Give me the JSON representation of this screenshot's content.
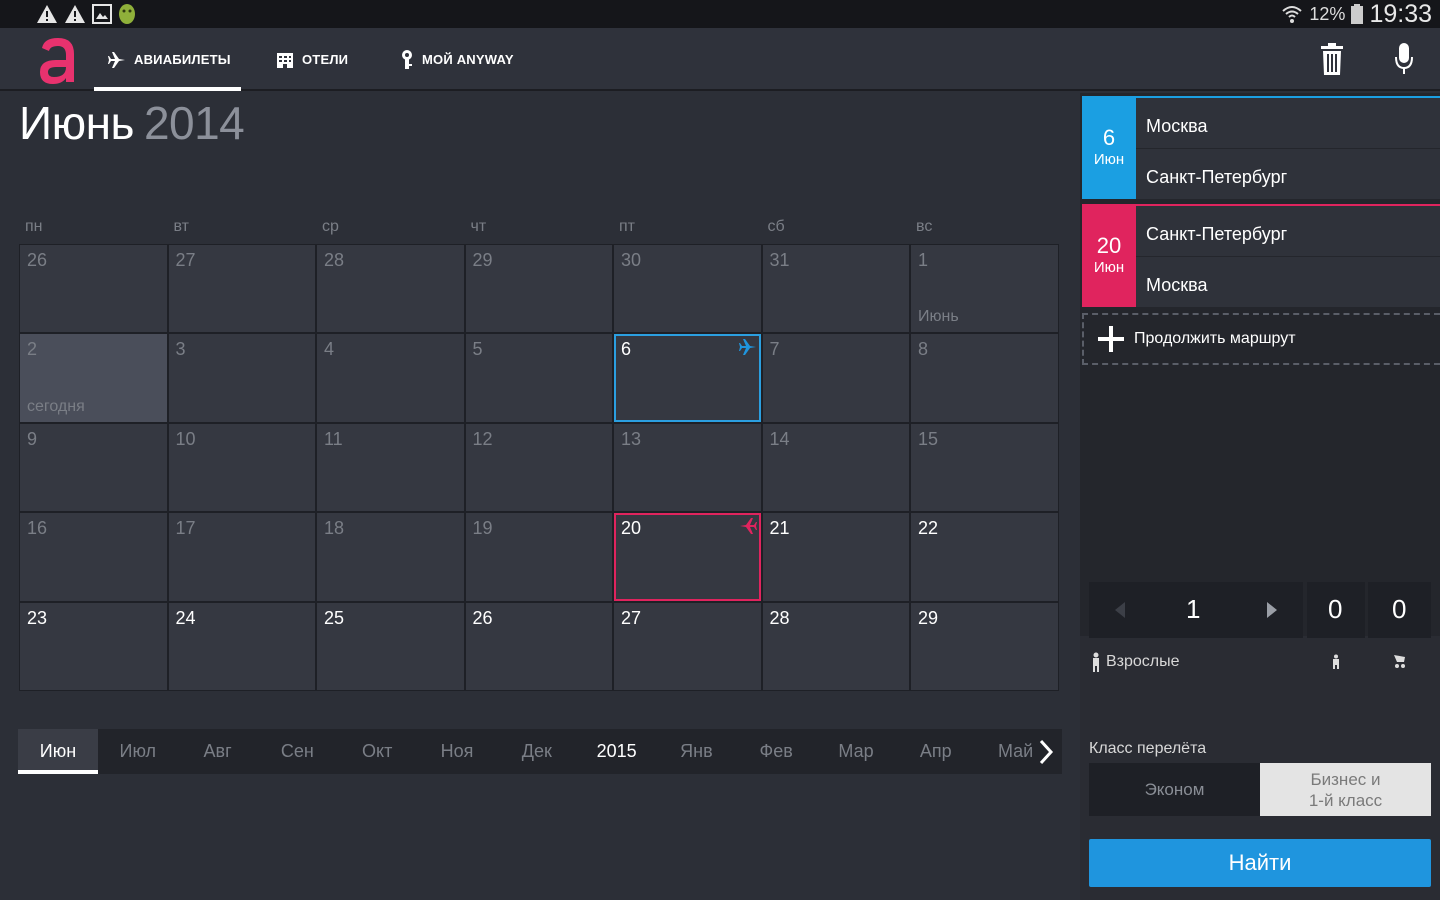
{
  "status_bar": {
    "battery_percent": "12%",
    "time": "19:33",
    "icons": [
      "warning-icon",
      "warning-icon",
      "image-icon",
      "android-icon",
      "wifi-icon",
      "battery-icon"
    ]
  },
  "app_bar": {
    "logo": "anyway-logo",
    "tabs": [
      {
        "label": "АВИАБИЛЕТЫ",
        "icon": "plane-icon",
        "active": true
      },
      {
        "label": "ОТЕЛИ",
        "icon": "hotel-icon",
        "active": false
      },
      {
        "label": "МОЙ ANYWAY",
        "icon": "key-icon",
        "active": false
      }
    ],
    "actions": [
      "trash-icon",
      "microphone-icon"
    ]
  },
  "calendar": {
    "month": "Июнь",
    "year": "2014",
    "weekdays": [
      "пн",
      "вт",
      "ср",
      "чт",
      "пт",
      "сб",
      "вс"
    ],
    "weeks": [
      [
        {
          "d": "26",
          "past": true
        },
        {
          "d": "27",
          "past": true
        },
        {
          "d": "28",
          "past": true
        },
        {
          "d": "29",
          "past": true
        },
        {
          "d": "30",
          "past": true
        },
        {
          "d": "31",
          "past": true
        },
        {
          "d": "1",
          "past": true,
          "sub": "Июнь"
        }
      ],
      [
        {
          "d": "2",
          "past": true,
          "today": true,
          "sub": "сегодня"
        },
        {
          "d": "3",
          "past": true
        },
        {
          "d": "4",
          "past": true
        },
        {
          "d": "5",
          "past": true
        },
        {
          "d": "6",
          "selected": "depart"
        },
        {
          "d": "7",
          "past": true
        },
        {
          "d": "8",
          "past": true
        }
      ],
      [
        {
          "d": "9",
          "past": true
        },
        {
          "d": "10",
          "past": true
        },
        {
          "d": "11",
          "past": true
        },
        {
          "d": "12",
          "past": true
        },
        {
          "d": "13",
          "past": true
        },
        {
          "d": "14",
          "past": true
        },
        {
          "d": "15",
          "past": true
        }
      ],
      [
        {
          "d": "16",
          "past": true
        },
        {
          "d": "17",
          "past": true
        },
        {
          "d": "18",
          "past": true
        },
        {
          "d": "19",
          "past": true
        },
        {
          "d": "20",
          "selected": "return"
        },
        {
          "d": "21"
        },
        {
          "d": "22"
        }
      ],
      [
        {
          "d": "23"
        },
        {
          "d": "24"
        },
        {
          "d": "25"
        },
        {
          "d": "26"
        },
        {
          "d": "27"
        },
        {
          "d": "28"
        },
        {
          "d": "29"
        }
      ]
    ]
  },
  "month_strip": {
    "items": [
      "Июн",
      "Июл",
      "Авг",
      "Сен",
      "Окт",
      "Ноя",
      "Дек",
      "2015",
      "Янв",
      "Фев",
      "Мар",
      "Апр",
      "Май"
    ],
    "active": "Июн",
    "year_marker": "2015"
  },
  "routes": [
    {
      "day": "6",
      "month": "Июн",
      "from": "Москва",
      "to": "Санкт-Петербург",
      "color": "#1b9fe2"
    },
    {
      "day": "20",
      "month": "Июн",
      "from": "Санкт-Петербург",
      "to": "Москва",
      "color": "#e0245e"
    }
  ],
  "continue_route": "Продолжить маршрут",
  "passengers": {
    "adults_label": "Взрослые",
    "adults": "1",
    "children": "0",
    "infants": "0"
  },
  "flight_class": {
    "label": "Класс перелёта",
    "economy": "Эконом",
    "business_line1": "Бизнес и",
    "business_line2": "1-й класс",
    "selected": "business"
  },
  "search_button": "Найти",
  "colors": {
    "accent_blue": "#1f95de",
    "accent_pink": "#e0245e",
    "logo": "#e8326e"
  }
}
